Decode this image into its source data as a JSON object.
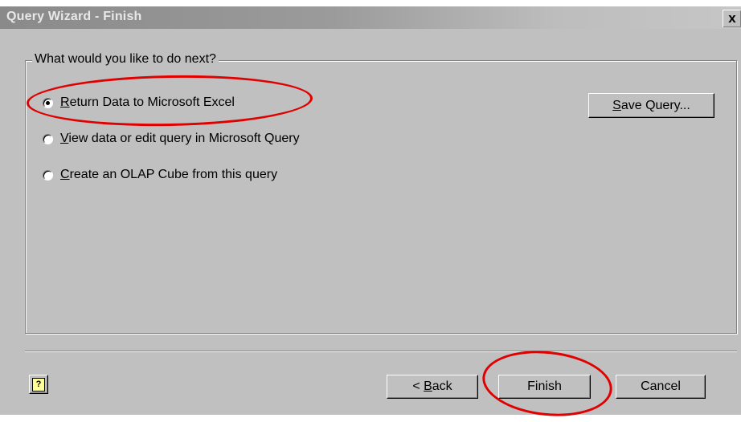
{
  "window": {
    "title": "Query Wizard - Finish",
    "close_label": "x"
  },
  "group": {
    "legend": "What would you like to do next?"
  },
  "options": [
    {
      "mnemonic": "R",
      "rest": "eturn Data to Microsoft Excel",
      "checked": true
    },
    {
      "mnemonic": "V",
      "rest": "iew data or edit query in Microsoft Query",
      "checked": false
    },
    {
      "mnemonic": "C",
      "rest": "reate an OLAP Cube from this query",
      "checked": false
    }
  ],
  "buttons": {
    "save_query": {
      "mnemonic": "S",
      "rest": "ave Query..."
    },
    "back": {
      "prefix": "< ",
      "mnemonic": "B",
      "rest": "ack"
    },
    "finish": "Finish",
    "cancel": "Cancel",
    "help_icon": "help-icon"
  },
  "annotations": {
    "color": "#e00000"
  }
}
